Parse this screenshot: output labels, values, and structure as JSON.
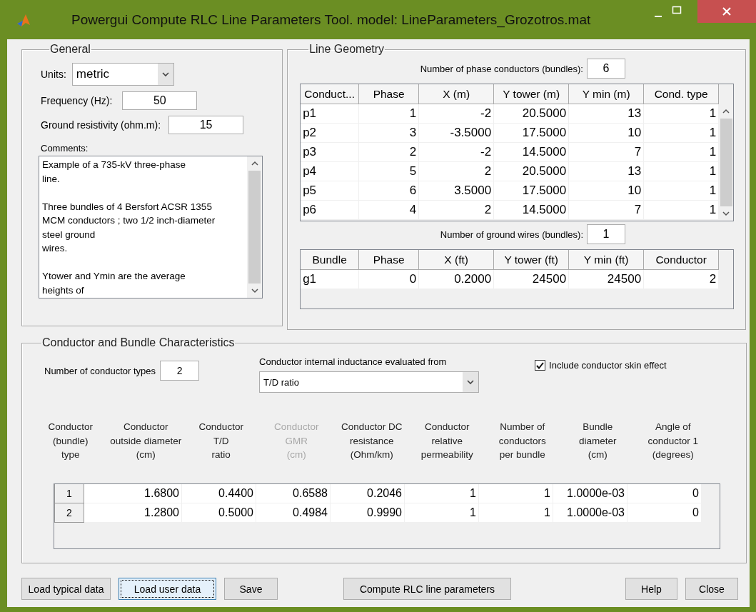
{
  "window": {
    "title": "Powergui Compute RLC Line Parameters Tool.  model: LineParameters_Grozotros.mat"
  },
  "general": {
    "title": "General",
    "units": {
      "label": "Units:",
      "value": "metric"
    },
    "frequency": {
      "label": "Frequency (Hz):",
      "value": "50"
    },
    "ground_resistivity": {
      "label": "Ground resistivity (ohm.m):",
      "value": "15"
    },
    "comments": {
      "label": "Comments:",
      "paragraphs": [
        [
          "Example of a 735-kV three-phase",
          "line."
        ],
        [
          "Three bundles of 4 Bersfort ACSR 1355",
          "MCM conductors ; two 1/2 inch-diameter",
          "steel ground",
          "wires."
        ],
        [
          "Ytower and Ymin are the average",
          "heights of"
        ]
      ]
    }
  },
  "line_geometry": {
    "title": "Line Geometry",
    "phase_conductors": {
      "label": "Number of phase conductors (bundles):",
      "value": "6"
    },
    "phase_table": {
      "columns": [
        "Conduct...",
        "Phase",
        "X (m)",
        "Y tower (m)",
        "Y min (m)",
        "Cond. type"
      ],
      "rows": [
        [
          "p1",
          "1",
          "-2",
          "20.5000",
          "13",
          "1"
        ],
        [
          "p2",
          "3",
          "-3.5000",
          "17.5000",
          "10",
          "1"
        ],
        [
          "p3",
          "2",
          "-2",
          "14.5000",
          "7",
          "1"
        ],
        [
          "p4",
          "5",
          "2",
          "20.5000",
          "13",
          "1"
        ],
        [
          "p5",
          "6",
          "3.5000",
          "17.5000",
          "10",
          "1"
        ],
        [
          "p6",
          "4",
          "2",
          "14.5000",
          "7",
          "1"
        ]
      ]
    },
    "ground_wires": {
      "label": "Number of ground wires (bundles):",
      "value": "1"
    },
    "ground_table": {
      "columns": [
        "Bundle",
        "Phase",
        "X (ft)",
        "Y tower (ft)",
        "Y min (ft)",
        "Conductor"
      ],
      "rows": [
        [
          "g1",
          "0",
          "0.2000",
          "24500",
          "24500",
          "2"
        ]
      ]
    }
  },
  "conductors": {
    "title": "Conductor and Bundle Characteristics",
    "types_count": {
      "label": "Number of conductor types",
      "value": "2"
    },
    "inductance": {
      "label": "Conductor internal inductance evaluated from",
      "value": "T/D ratio"
    },
    "skin_effect": {
      "label": "Include conductor skin effect",
      "checked": true
    },
    "columns": [
      {
        "lines": [
          "Conductor",
          "(bundle)",
          "type"
        ],
        "disabled": false
      },
      {
        "lines": [
          "Conductor",
          "outside diameter",
          "(cm)"
        ],
        "disabled": false
      },
      {
        "lines": [
          "Conductor",
          "T/D",
          "ratio"
        ],
        "disabled": false
      },
      {
        "lines": [
          "Conductor",
          "GMR",
          "(cm)"
        ],
        "disabled": true
      },
      {
        "lines": [
          "Conductor DC",
          "resistance",
          "(Ohm/km)"
        ],
        "disabled": false
      },
      {
        "lines": [
          "Conductor",
          "relative",
          "permeability"
        ],
        "disabled": false
      },
      {
        "lines": [
          "Number of",
          "conductors",
          "per bundle"
        ],
        "disabled": false
      },
      {
        "lines": [
          "Bundle",
          "diameter",
          "(cm)"
        ],
        "disabled": false
      },
      {
        "lines": [
          "Angle of",
          "conductor 1",
          "(degrees)"
        ],
        "disabled": false
      }
    ],
    "rows": [
      {
        "type": "1",
        "values": [
          "1.6800",
          "0.4400",
          "0.6588",
          "0.2046",
          "1",
          "1",
          "1.0000e-03",
          "0"
        ]
      },
      {
        "type": "2",
        "values": [
          "1.2800",
          "0.5000",
          "0.4984",
          "0.9990",
          "1",
          "1",
          "1.0000e-03",
          "0"
        ]
      }
    ]
  },
  "buttons": [
    {
      "label": "Load typical data",
      "focused": false
    },
    {
      "label": "Load user data",
      "focused": true
    },
    {
      "label": "Save",
      "focused": false
    },
    {
      "label": "Compute RLC line parameters",
      "focused": false
    },
    {
      "label": "Help",
      "focused": false
    },
    {
      "label": "Close",
      "focused": false
    }
  ]
}
